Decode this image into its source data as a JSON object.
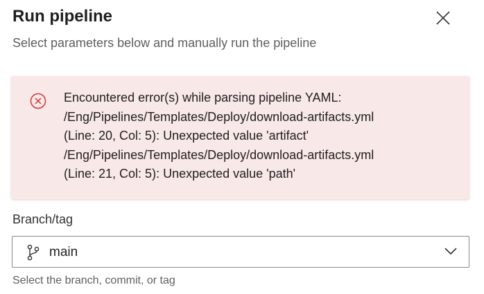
{
  "dialog": {
    "title": "Run pipeline",
    "subtitle": "Select parameters below and manually run the pipeline",
    "close_icon": "close-icon"
  },
  "error": {
    "icon": "error-circle-x-icon",
    "color": "#d13438",
    "background": "#f8e8e8",
    "lines": [
      "Encountered error(s) while parsing pipeline YAML:",
      "/Eng/Pipelines/Templates/Deploy/download-artifacts.yml",
      "(Line: 20, Col: 5): Unexpected value 'artifact'",
      "/Eng/Pipelines/Templates/Deploy/download-artifacts.yml",
      "(Line: 21, Col: 5): Unexpected value 'path'"
    ]
  },
  "branch": {
    "label": "Branch/tag",
    "value": "main",
    "icon": "git-branch-icon",
    "dropdown_icon": "chevron-down-icon",
    "helper": "Select the branch, commit, or tag"
  }
}
